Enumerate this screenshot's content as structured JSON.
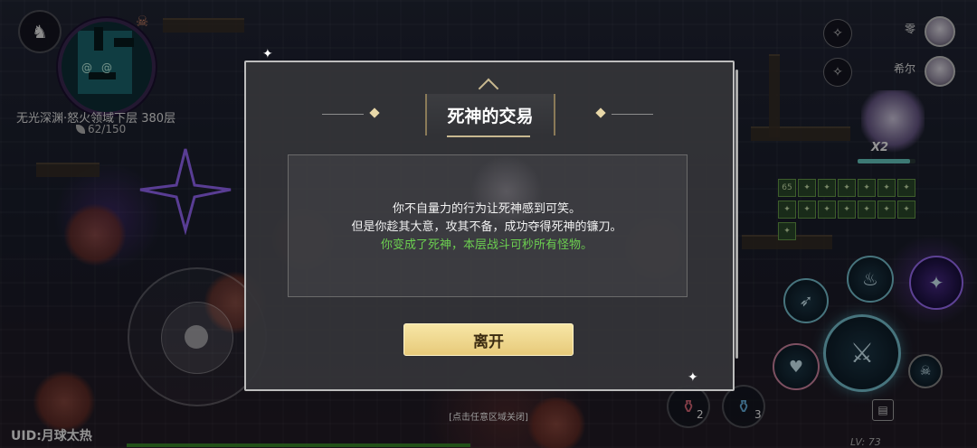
{
  "hud": {
    "back_icon": "horse-head-icon",
    "location": "无光深渊·怒火领域下层 380层",
    "energy": "62/150",
    "uid": "UID:月球太热",
    "level": "LV: 73"
  },
  "party": [
    {
      "name": "零",
      "icon": "scythe-slash-icon"
    },
    {
      "name": "希尔",
      "icon": "scythe-slash-icon"
    }
  ],
  "hero": {
    "combo": "X2",
    "hp_fraction": 0.9
  },
  "buffs": [
    "65",
    "✦",
    "✦",
    "✦",
    "✦",
    "✦",
    "✦",
    "✦",
    "✦",
    "✦",
    "✦",
    "✦",
    "✦",
    "✦",
    "✦"
  ],
  "items": {
    "potion_red_count": "2",
    "potion_blue_count": "3"
  },
  "dialog": {
    "title": "死神的交易",
    "line1": "你不自量力的行为让死神感到可笑。",
    "line2": "但是你趁其大意，攻其不备，成功夺得死神的镰刀。",
    "line3": "你变成了死神，本层战斗可秒所有怪物。",
    "leave_button": "离开",
    "close_hint": "[点击任意区域关闭]"
  },
  "colors": {
    "accent_gold": "#e7ca7a",
    "success_green": "#6ccf50",
    "skill_cyan": "#7ac8d8"
  }
}
